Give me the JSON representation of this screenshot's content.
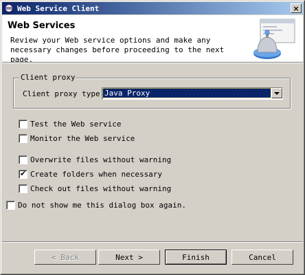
{
  "window": {
    "title": "Web Service Client",
    "close_glyph": "×"
  },
  "header": {
    "title": "Web Services",
    "description": "Review your Web service options and make any necessary changes before proceeding to the next page."
  },
  "client_proxy": {
    "group_label": "Client proxy",
    "type_label": "Client proxy type:",
    "type_value": "Java Proxy"
  },
  "options": [
    {
      "label": "Test the Web service",
      "checked": false
    },
    {
      "label": "Monitor the Web service",
      "checked": false
    },
    {
      "label": "Overwrite files without warning",
      "checked": false
    },
    {
      "label": "Create folders when necessary",
      "checked": true
    },
    {
      "label": "Check out files without warning",
      "checked": false
    }
  ],
  "dont_show": {
    "label": "Do not show me this dialog box again.",
    "checked": false
  },
  "buttons": {
    "back": "< Back",
    "next": "Next >",
    "finish": "Finish",
    "cancel": "Cancel"
  },
  "checkmark_glyph": "✔",
  "colors": {
    "face": "#d4d0c8",
    "title_start": "#0a246a",
    "title_end": "#a6caf0",
    "selection": "#0a246a"
  }
}
